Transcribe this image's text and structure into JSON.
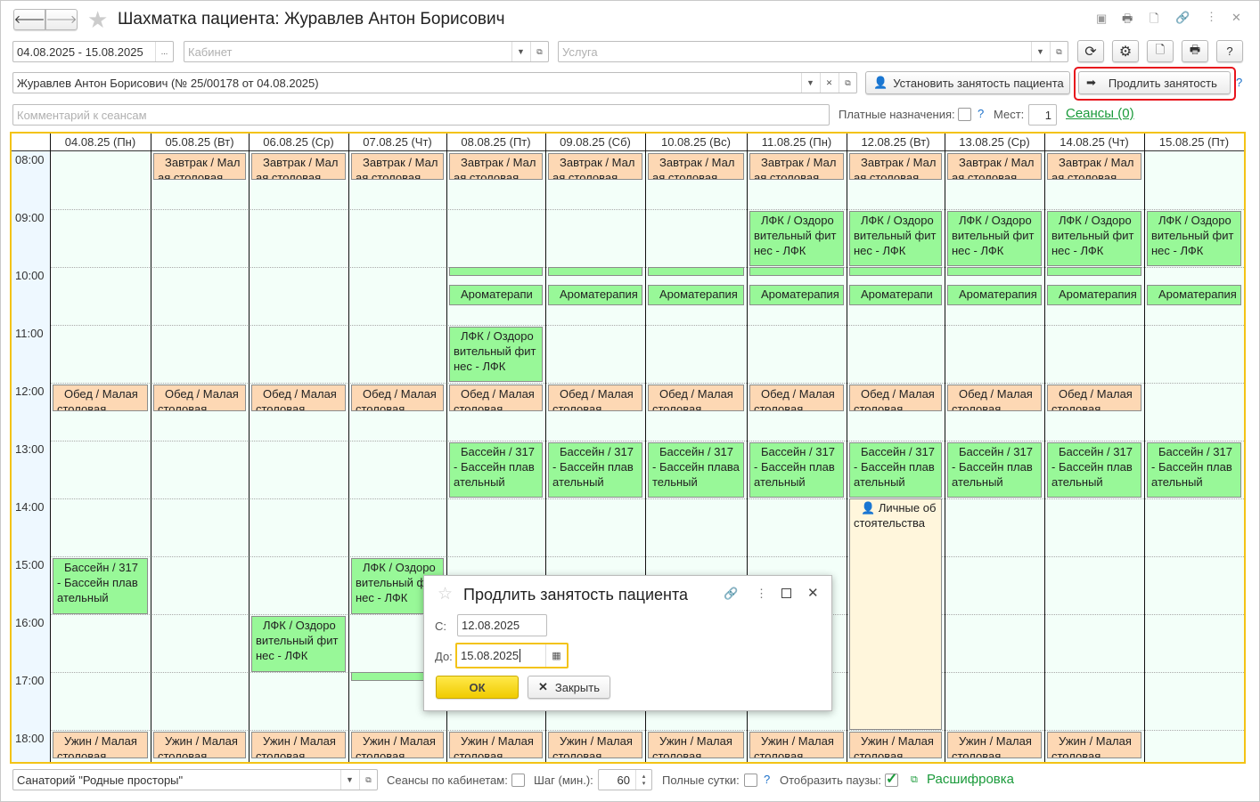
{
  "window": {
    "title": "Шахматка пациента: Журавлев Антон Борисович"
  },
  "filters": {
    "period": "04.08.2025 - 15.08.2025",
    "period_btn": "...",
    "cabinet_placeholder": "Кабинет",
    "service_placeholder": "Услуга",
    "patient": "Журавлев Антон Борисович (№ 25/00178 от 04.08.2025)",
    "comment_placeholder": "Комментарий к сеансам",
    "set_busy_label": "Установить занятость пациента",
    "extend_label": "Продлить занятость",
    "paid_label": "Платные назначения:",
    "places_label": "Мест:",
    "places_value": "1",
    "sessions_link": "Сеансы (0)",
    "help": "?"
  },
  "schedule": {
    "days": [
      "04.08.25 (Пн)",
      "05.08.25 (Вт)",
      "06.08.25 (Ср)",
      "07.08.25 (Чт)",
      "08.08.25 (Пт)",
      "09.08.25 (Сб)",
      "10.08.25 (Вс)",
      "11.08.25 (Пн)",
      "12.08.25 (Вт)",
      "13.08.25 (Ср)",
      "14.08.25 (Чт)",
      "15.08.25 (Пт)"
    ],
    "hours": [
      "08:00",
      "09:00",
      "10:00",
      "11:00",
      "12:00",
      "13:00",
      "14:00",
      "15:00",
      "16:00",
      "17:00",
      "18:00"
    ],
    "events": [
      {
        "days": [
          1,
          2,
          3,
          4,
          5,
          6,
          7,
          8,
          9,
          10
        ],
        "start": 8.03,
        "end": 8.5,
        "type": "meal",
        "text": "Завтрак / Малая столовая"
      },
      {
        "days": [
          7,
          8,
          9,
          10,
          11
        ],
        "start": 9.03,
        "end": 9.98,
        "type": "act",
        "text": "ЛФК / Оздоровительный фитнес - ЛФК"
      },
      {
        "days": [
          4,
          5,
          6,
          7,
          8,
          9,
          10
        ],
        "start": 10.0,
        "end": 10.16,
        "type": "act",
        "text": ""
      },
      {
        "days": [
          4,
          5,
          6,
          7,
          8,
          9,
          10,
          11
        ],
        "start": 10.31,
        "end": 10.66,
        "type": "act",
        "text": "Ароматерапия"
      },
      {
        "days": [
          4
        ],
        "start": 11.03,
        "end": 11.98,
        "type": "act",
        "text": "ЛФК / Оздоровительный фитнес - ЛФК"
      },
      {
        "days": [
          0,
          1,
          2,
          3,
          4,
          5,
          6,
          7,
          8,
          9,
          10
        ],
        "start": 12.03,
        "end": 12.5,
        "type": "meal",
        "text": "Обед / Малая столовая"
      },
      {
        "days": [
          4,
          5,
          6,
          7,
          8,
          9,
          10,
          11
        ],
        "start": 13.03,
        "end": 13.98,
        "type": "act",
        "text": "Бассейн / 317 - Бассейн плавательный"
      },
      {
        "days": [
          8
        ],
        "start": 14.0,
        "end": 18.0,
        "type": "pers",
        "text": "Личные обстоятельства"
      },
      {
        "days": [
          0
        ],
        "start": 15.03,
        "end": 16.0,
        "type": "act",
        "text": "Бассейн / 317 - Бассейн плавательный"
      },
      {
        "days": [
          3
        ],
        "start": 15.03,
        "end": 16.0,
        "type": "act",
        "text": "ЛФК / Оздоровительный фитнес - ЛФК"
      },
      {
        "days": [
          2
        ],
        "start": 16.03,
        "end": 17.0,
        "type": "act",
        "text": "ЛФК / Оздоровительный фитнес - ЛФК"
      },
      {
        "days": [
          3
        ],
        "start": 17.0,
        "end": 17.16,
        "type": "act",
        "text": ""
      },
      {
        "days": [
          0,
          1,
          2,
          3,
          4,
          5,
          6,
          7,
          8,
          9,
          10
        ],
        "start": 18.03,
        "end": 18.5,
        "type": "meal",
        "text": "Ужин / Малая столовая"
      }
    ]
  },
  "bottom": {
    "org": "Санаторий \"Родные просторы\"",
    "by_cabinet_label": "Сеансы по кабинетам:",
    "step_label": "Шаг (мин.):",
    "step_value": "60",
    "full_day_label": "Полные сутки:",
    "pauses_label": "Отобразить паузы:",
    "legend_link": "Расшифровка"
  },
  "dialog": {
    "title": "Продлить занятость пациента",
    "from_label": "С:",
    "from_value": "12.08.2025",
    "to_label": "До:",
    "to_value": "15.08.2025",
    "ok": "ОК",
    "close": "Закрыть"
  },
  "colors": {
    "meal": "#fdd8b4",
    "activity": "#98f898",
    "personal": "#fff6dc",
    "accent": "#f3c316",
    "highlight": "#e8141c"
  }
}
